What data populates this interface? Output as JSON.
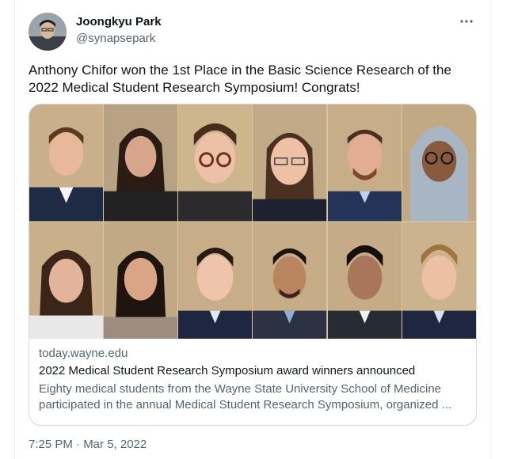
{
  "author": {
    "name": "Joongkyu Park",
    "handle": "@synapsepark"
  },
  "menu": {
    "more_icon": "more-horizontal-icon"
  },
  "tweet": {
    "text": "Anthony Chifor won the 1st Place in the Basic Science Research of the 2022 Medical Student Research Symposium! Congrats!",
    "timestamp": "7:25 PM · Mar 5, 2022"
  },
  "link_card": {
    "domain": "today.wayne.edu",
    "title": "2022 Medical Student Research Symposium award winners announced",
    "description": "Eighty medical students from the Wayne State University School of Medicine participated in the annual Medical Student Research Symposium, organized ...",
    "image_description": "Grid of 12 headshot portraits"
  },
  "colors": {
    "text": "#0f1419",
    "secondary": "#536471",
    "border": "#cfd9de",
    "portrait_bg": "#cdb58e"
  }
}
